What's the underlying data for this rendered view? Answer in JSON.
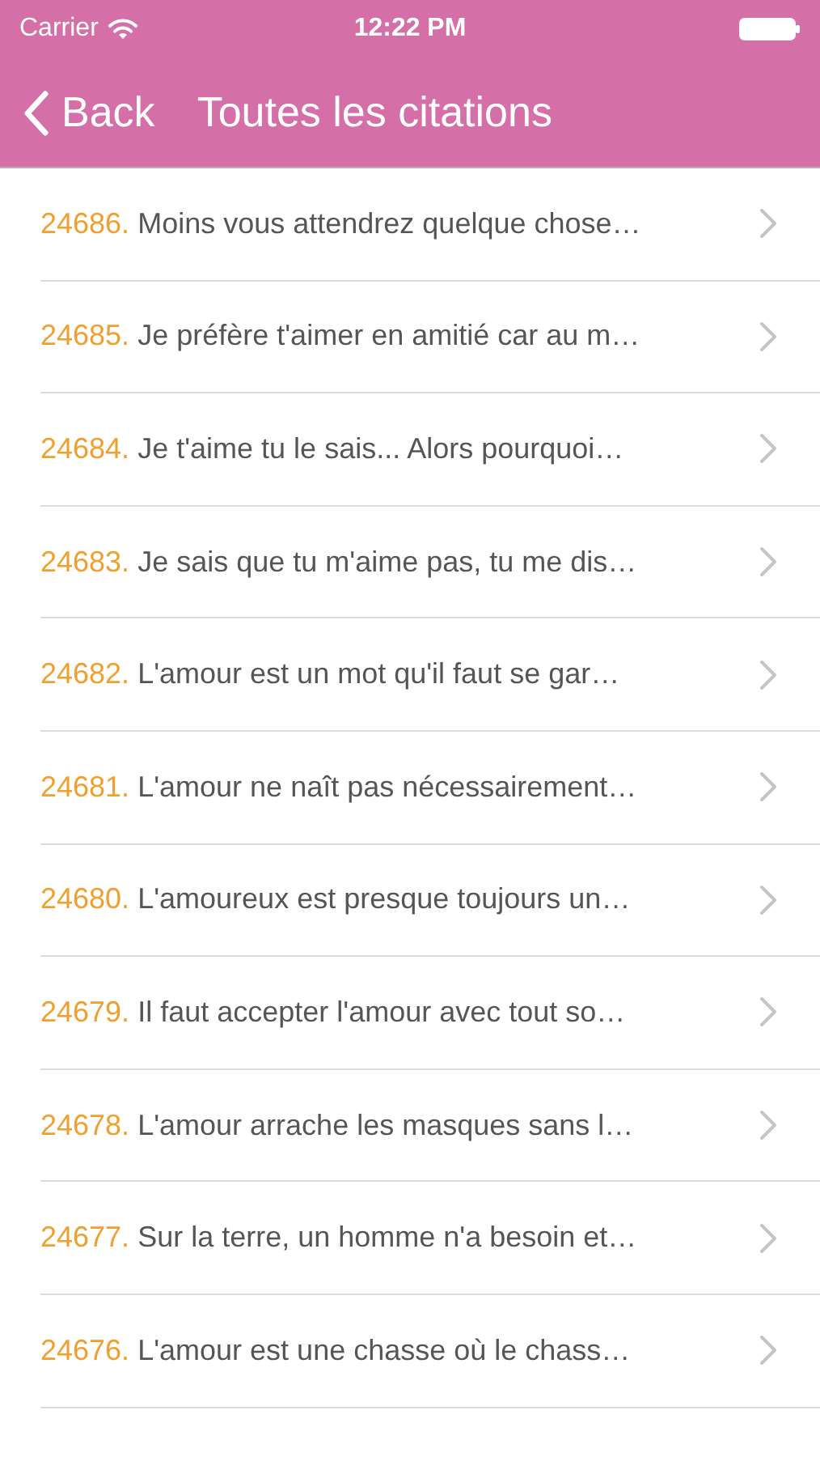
{
  "status_bar": {
    "carrier": "Carrier",
    "time": "12:22 PM"
  },
  "nav_bar": {
    "back": "Back",
    "title": "Toutes les citations"
  },
  "quotes": [
    {
      "number": "24686.",
      "text": "Moins vous attendrez quelque chose…"
    },
    {
      "number": "24685.",
      "text": "Je préfère t'aimer en amitié car au m…"
    },
    {
      "number": "24684.",
      "text": "Je t'aime tu le sais... Alors pourquoi…"
    },
    {
      "number": "24683.",
      "text": "Je sais que tu m'aime pas, tu me dis…"
    },
    {
      "number": "24682.",
      "text": "L'amour est un mot qu'il faut se gar…"
    },
    {
      "number": "24681.",
      "text": "L'amour ne naît pas nécessairement…"
    },
    {
      "number": "24680.",
      "text": "L'amoureux est presque toujours un…"
    },
    {
      "number": "24679.",
      "text": "Il faut accepter l'amour avec tout so…"
    },
    {
      "number": "24678.",
      "text": "L'amour arrache les masques sans l…"
    },
    {
      "number": "24677.",
      "text": "Sur la terre, un homme n'a besoin et…"
    },
    {
      "number": "24676.",
      "text": "L'amour est une chasse où le chass…"
    }
  ]
}
